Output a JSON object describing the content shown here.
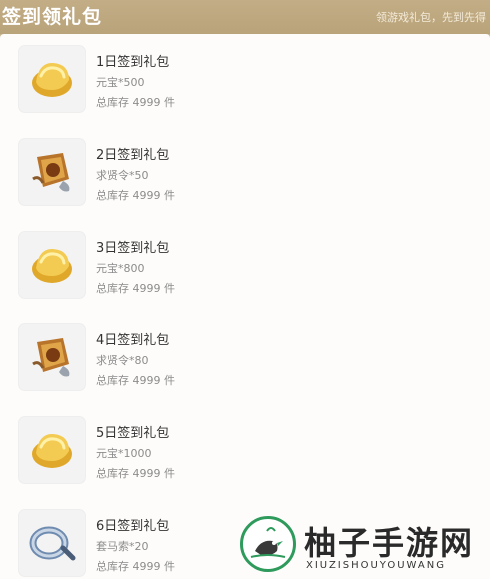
{
  "header": {
    "title": "签到领礼包",
    "subtitle": "领游戏礼包，先到先得"
  },
  "items": [
    {
      "name": "1日签到礼包",
      "reward": "元宝*500",
      "stock": "总库存 4999 件",
      "icon": "gold-ingot-icon"
    },
    {
      "name": "2日签到礼包",
      "reward": "求贤令*50",
      "stock": "总库存 4999 件",
      "icon": "scroll-token-icon"
    },
    {
      "name": "3日签到礼包",
      "reward": "元宝*800",
      "stock": "总库存 4999 件",
      "icon": "gold-ingot-icon"
    },
    {
      "name": "4日签到礼包",
      "reward": "求贤令*80",
      "stock": "总库存 4999 件",
      "icon": "scroll-token-icon"
    },
    {
      "name": "5日签到礼包",
      "reward": "元宝*1000",
      "stock": "总库存 4999 件",
      "icon": "gold-ingot-icon"
    },
    {
      "name": "6日签到礼包",
      "reward": "套马索*20",
      "stock": "总库存 4999 件",
      "icon": "lasso-rope-icon"
    }
  ],
  "watermark": {
    "text": "柚子手游网",
    "sub": "XIUZISHOUYOUWANG",
    "color": "#2e9a5b"
  },
  "colors": {
    "header_bg": "#c2ad86",
    "panel_bg": "#fdfcfa",
    "gold": "#e8b93a"
  }
}
